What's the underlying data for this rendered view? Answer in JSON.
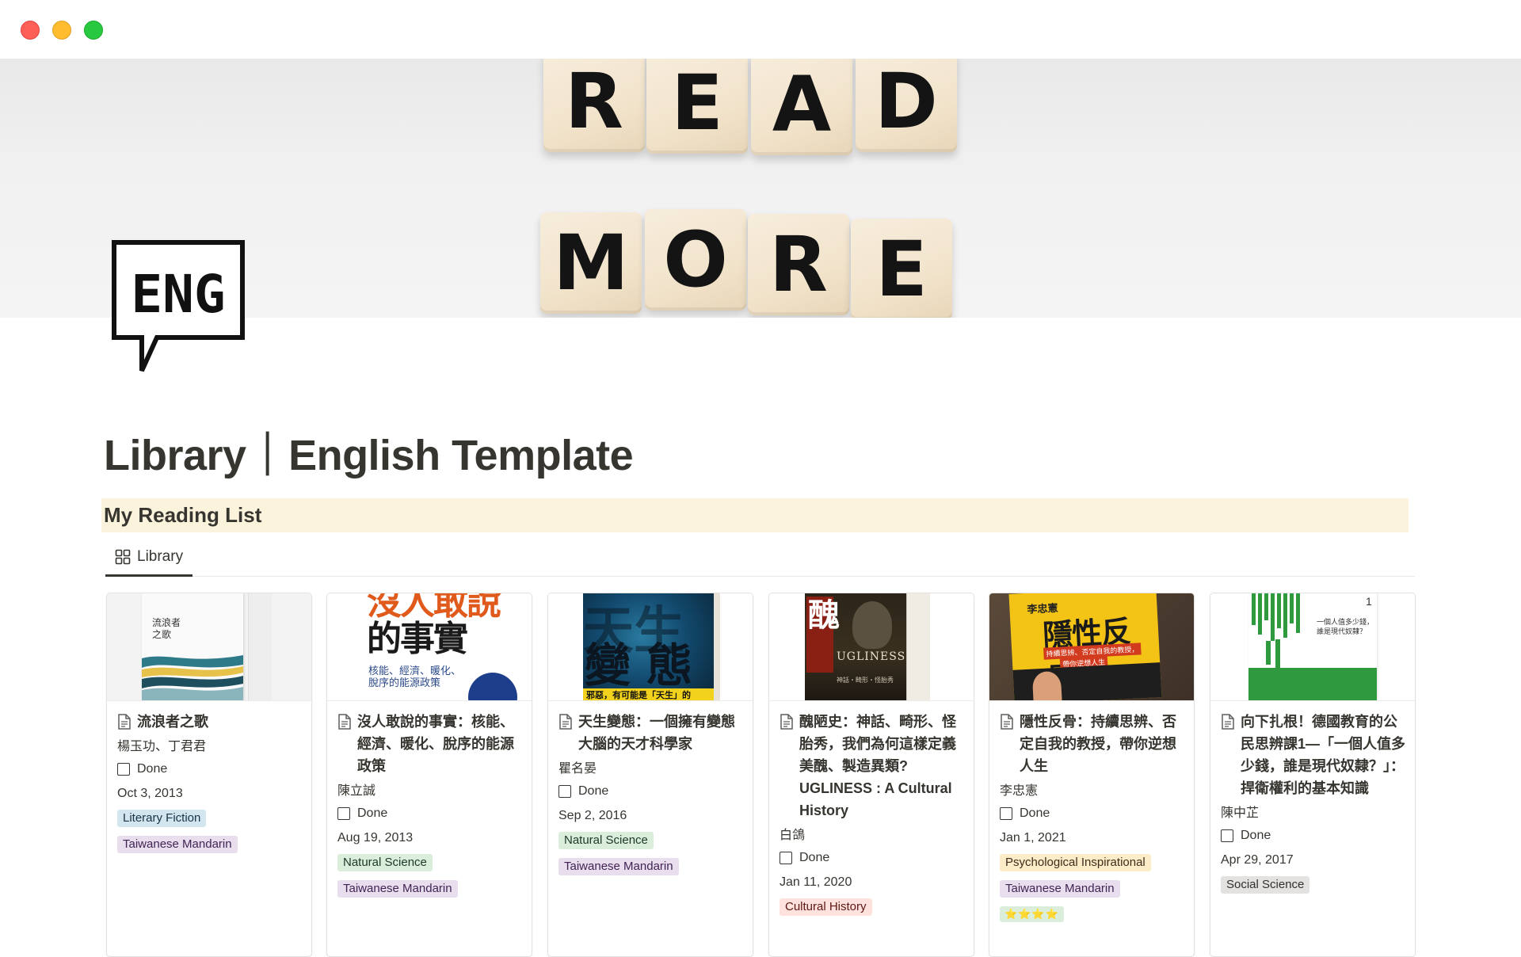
{
  "window": {
    "controls": [
      "close",
      "minimize",
      "zoom"
    ]
  },
  "cover": {
    "row1": [
      "R",
      "E",
      "A",
      "D"
    ],
    "row2": [
      "M",
      "O",
      "R",
      "E"
    ]
  },
  "page_icon": {
    "text": "ENG",
    "icon": "speech-bubble-icon"
  },
  "page_title": "Library｜English Template",
  "callout": {
    "title": "My Reading List"
  },
  "view": {
    "tab_label": "Library",
    "tab_icon": "gallery-view-icon"
  },
  "cards": [
    {
      "title": "流浪者之歌",
      "cover_text": [
        "流浪者",
        "之歌"
      ],
      "author": "楊玉功、丁君君",
      "status": "Done",
      "date": "Oct 3, 2013",
      "tags": [
        {
          "label": "Literary Fiction",
          "bg": "#d3e5ef",
          "fg": "#183347"
        },
        {
          "label": "Taiwanese Mandarin",
          "bg": "#e8deee",
          "fg": "#412454"
        }
      ]
    },
    {
      "title": "沒人敢說的事實：核能、經濟、暖化、脫序的能源政策",
      "cover_text": [
        "沒人敢說",
        "的事實",
        "核能、經濟、暖化、",
        "脫序的能源政策"
      ],
      "author": "陳立誠",
      "status": "Done",
      "date": "Aug 19, 2013",
      "tags": [
        {
          "label": "Natural Science",
          "bg": "#dbeddb",
          "fg": "#1c3829"
        },
        {
          "label": "Taiwanese Mandarin",
          "bg": "#e8deee",
          "fg": "#412454"
        }
      ]
    },
    {
      "title": "天生變態：一個擁有變態大腦的天才科學家",
      "cover_text": [
        "變",
        "態",
        "邪惡，有可能是「天生」的"
      ],
      "author": "瞿名晏",
      "status": "Done",
      "date": "Sep 2, 2016",
      "tags": [
        {
          "label": "Natural Science",
          "bg": "#dbeddb",
          "fg": "#1c3829"
        },
        {
          "label": "Taiwanese Mandarin",
          "bg": "#e8deee",
          "fg": "#412454"
        }
      ]
    },
    {
      "title": "醜陋史：神話、畸形、怪胎秀，我們為何這樣定義美醜、製造異類? UGLINESS : A Cultural History",
      "cover_text": [
        "醜",
        "UGLINESS",
        "神話・畸形・怪胎秀"
      ],
      "author": "白鴿",
      "status": "Done",
      "date": "Jan 11, 2020",
      "tags": [
        {
          "label": "Cultural History",
          "bg": "#ffe2dd",
          "fg": "#5d1715"
        }
      ]
    },
    {
      "title": "隱性反骨：持續思辨、否定自我的教授，帶你逆想人生",
      "cover_text": [
        "李忠憲",
        "隱性反骨",
        "持續思辨、否定自我的教授，",
        "帶你逆想人生"
      ],
      "author": "李忠憲",
      "status": "Done",
      "date": "Jan 1, 2021",
      "tags": [
        {
          "label": "Psychological Inspirational",
          "bg": "#fdecc8",
          "fg": "#402c1b"
        },
        {
          "label": "Taiwanese Mandarin",
          "bg": "#e8deee",
          "fg": "#412454"
        }
      ],
      "rating": "⭐⭐⭐⭐"
    },
    {
      "title": "向下扎根！德國教育的公民思辨課1—「一個人值多少錢，誰是現代奴隸？」：捍衛權利的基本知識",
      "cover_text": [
        "1",
        "一個人值多少錢，",
        "誰是現代奴隸？"
      ],
      "author": "陳中芷",
      "status": "Done",
      "date": "Apr 29, 2017",
      "tags": [
        {
          "label": "Social Science",
          "bg": "#e3e2e0",
          "fg": "#32302c"
        }
      ]
    }
  ]
}
